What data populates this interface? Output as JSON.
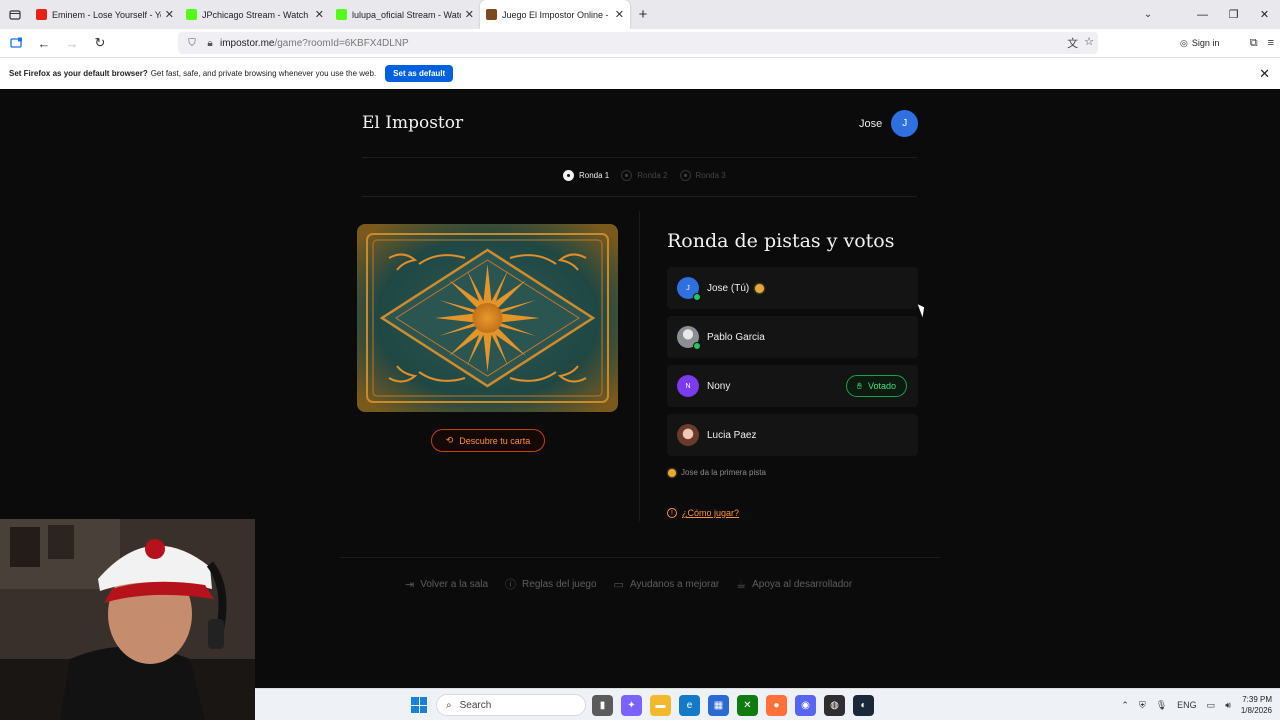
{
  "browser": {
    "tabs": [
      {
        "title": "Eminem - Lose Yourself - YouTu",
        "favicon_color": "#e62117",
        "active": false
      },
      {
        "title": "JPchicago Stream - Watch Live o",
        "favicon_color": "#53fc18",
        "active": false
      },
      {
        "title": "lulupa_oficial Stream - Watch Li",
        "favicon_color": "#53fc18",
        "active": false
      },
      {
        "title": "Juego El Impostor Online - Jug",
        "favicon_color": "#7a4a1e",
        "active": true
      }
    ],
    "new_tab_label": "+",
    "url_host": "impostor.me",
    "url_path": "/game?roomId=6KBFX4DLNP",
    "signin_label": "Sign in"
  },
  "notification": {
    "bold": "Set Firefox as your default browser?",
    "text": "Get fast, safe, and private browsing whenever you use the web.",
    "cta": "Set as default"
  },
  "page": {
    "brand": "El Impostor",
    "user_name": "Jose",
    "user_initial": "J",
    "rounds": [
      {
        "label": "Ronda 1",
        "active": true
      },
      {
        "label": "Ronda 2",
        "active": false
      },
      {
        "label": "Ronda 3",
        "active": false
      }
    ],
    "reveal_button": "Descubre tu carta",
    "section_title": "Ronda de pistas y votos",
    "players": [
      {
        "name": "Jose (Tú)",
        "initial": "J",
        "avatar_color": "#2f6fe0",
        "online": true,
        "clue_giver": true,
        "voted": false
      },
      {
        "name": "Pablo Garcia",
        "initial": "",
        "avatar_color": "#9aa0a6",
        "online": true,
        "clue_giver": false,
        "voted": false
      },
      {
        "name": "Nony",
        "initial": "N",
        "avatar_color": "#7c3aed",
        "online": false,
        "clue_giver": false,
        "voted": true
      },
      {
        "name": "Lucia Paez",
        "initial": "",
        "avatar_color": "#c98d7a",
        "online": false,
        "clue_giver": false,
        "voted": false
      }
    ],
    "voted_label": "Votado",
    "hint": "Jose da la primera pista",
    "howto": "¿Cómo jugar?",
    "footer": [
      {
        "label": "Volver a la sala",
        "icon": "exit-icon"
      },
      {
        "label": "Reglas del juego",
        "icon": "info-icon"
      },
      {
        "label": "Ayudanos a mejorar",
        "icon": "feedback-icon"
      },
      {
        "label": "Apoya al desarrollador",
        "icon": "coffee-icon"
      }
    ],
    "accent": "#fb923c"
  },
  "taskbar": {
    "search_placeholder": "Search",
    "language": "ENG",
    "time": "7:39 PM",
    "date": "1/8/2026"
  }
}
